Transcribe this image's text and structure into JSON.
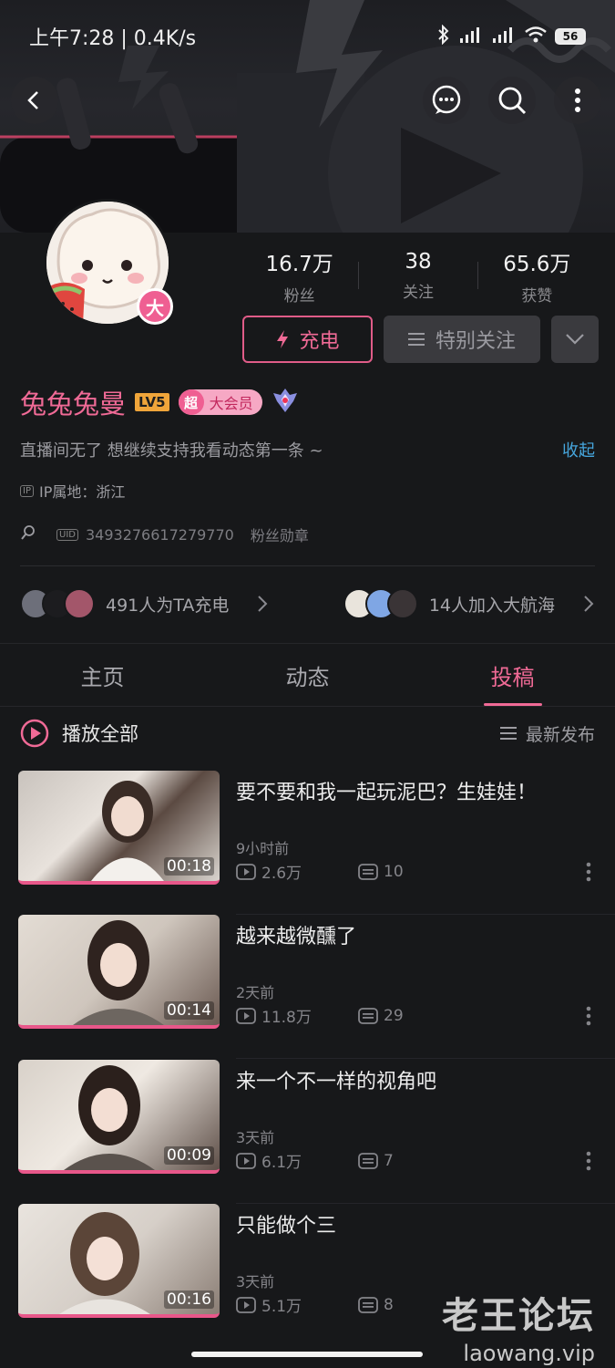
{
  "status_bar": {
    "time_speed": "上午7:28 | 0.4K/s",
    "battery": "56"
  },
  "profile": {
    "username": "兔兔兔曼",
    "level": "LV5",
    "vip_icon_text": "超",
    "vip_label": "大会员",
    "avatar_badge": "大",
    "bio": "直播间无了 想继续支持我看动态第一条 ~",
    "collapse_label": "收起",
    "ip_tag": "IP",
    "ip_location": "IP属地：浙江",
    "uid_tag": "UID",
    "uid": "3493276617279770",
    "fan_medal": "粉丝勋章"
  },
  "stats": [
    {
      "value": "16.7万",
      "label": "粉丝"
    },
    {
      "value": "38",
      "label": "关注"
    },
    {
      "value": "65.6万",
      "label": "获赞"
    }
  ],
  "actions": {
    "charge_label": "充电",
    "special_follow_label": "特别关注"
  },
  "supporters": {
    "charge_text": "491人为TA充电",
    "fleet_text": "14人加入大航海"
  },
  "tabs": [
    {
      "label": "主页",
      "active": false
    },
    {
      "label": "动态",
      "active": false
    },
    {
      "label": "投稿",
      "active": true
    }
  ],
  "video_list": {
    "play_all_label": "播放全部",
    "sort_label": "最新发布",
    "videos": [
      {
        "title": "要不要和我一起玩泥巴？生娃娃！",
        "time": "9小时前",
        "views": "2.6万",
        "comments": "10",
        "duration": "00:18"
      },
      {
        "title": "越来越微醺了",
        "time": "2天前",
        "views": "11.8万",
        "comments": "29",
        "duration": "00:14"
      },
      {
        "title": "来一个不一样的视角吧",
        "time": "3天前",
        "views": "6.1万",
        "comments": "7",
        "duration": "00:09"
      },
      {
        "title": "只能做个三",
        "time": "3天前",
        "views": "5.1万",
        "comments": "8",
        "duration": "00:16"
      }
    ]
  },
  "watermark": {
    "title": "老王论坛",
    "site": "laowang.vip"
  },
  "colors": {
    "accent_pink": "#f06a96",
    "link_blue": "#46a6dd",
    "background": "#17181a"
  }
}
